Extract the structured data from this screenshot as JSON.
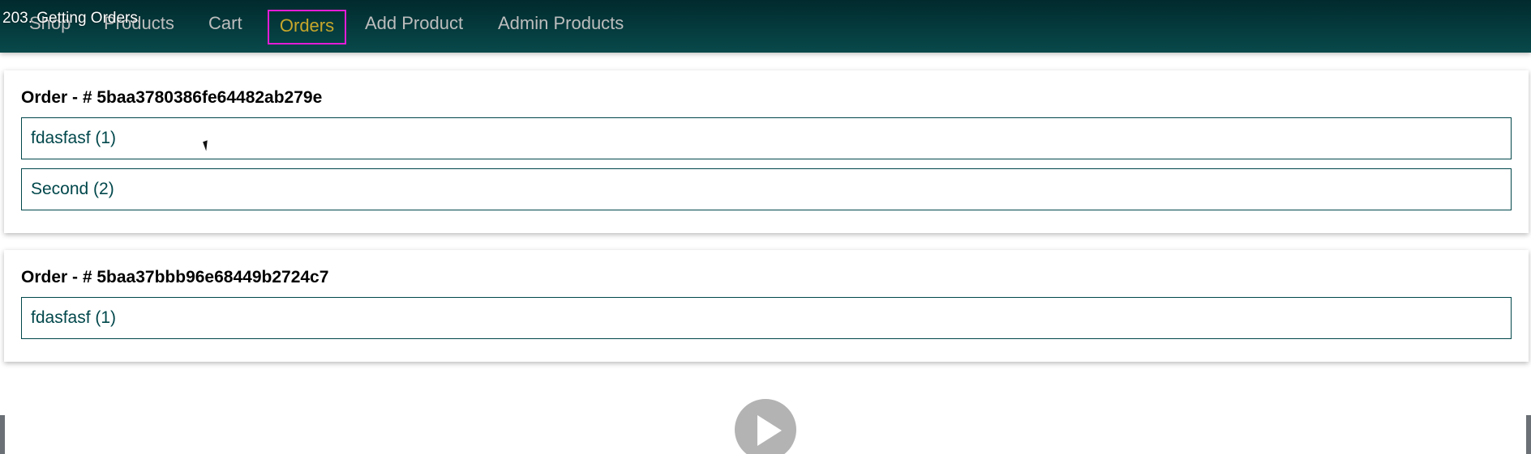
{
  "video_title": "203. Getting Orders",
  "nav": {
    "items": [
      {
        "label": "Shop"
      },
      {
        "label": "Products"
      },
      {
        "label": "Cart"
      },
      {
        "label": "Orders",
        "active": true
      },
      {
        "label": "Add Product"
      },
      {
        "label": "Admin Products"
      }
    ]
  },
  "orders": [
    {
      "title": "Order - # 5baa3780386fe64482ab279e",
      "items": [
        {
          "label": "fdasfasf (1)"
        },
        {
          "label": "Second (2)"
        }
      ]
    },
    {
      "title": "Order - # 5baa37bbb96e68449b2724c7",
      "items": [
        {
          "label": "fdasfasf (1)"
        }
      ]
    }
  ],
  "colors": {
    "nav_gradient_top": "#012a2d",
    "nav_gradient_bottom": "#08494b",
    "nav_text": "#bdbdbd",
    "nav_active_text": "#c7a72b",
    "nav_active_outline": "#e31cd6",
    "item_border": "#00474b",
    "item_text": "#00474b"
  },
  "icons": {
    "play": "play-icon",
    "cursor": "mouse-cursor-icon"
  }
}
